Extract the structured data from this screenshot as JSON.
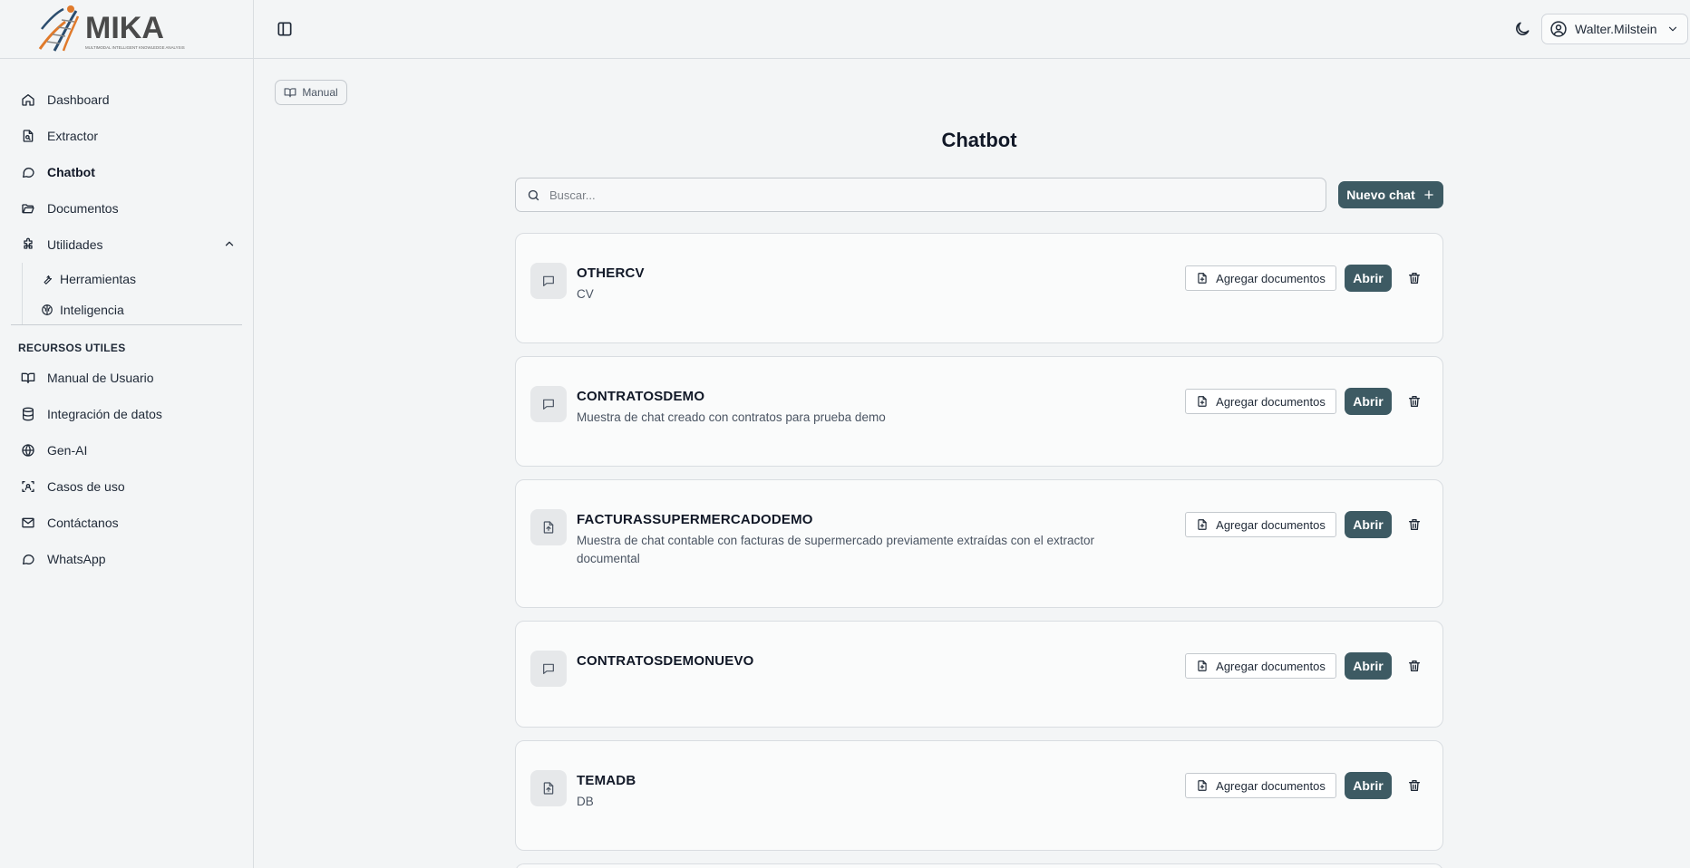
{
  "brand": {
    "name": "MIKA",
    "tagline": "MULTIMODAL INTELLIGENT KNOWLEDGE ANALYSIS"
  },
  "sidebar": {
    "items": [
      {
        "label": "Dashboard",
        "icon": "home-icon"
      },
      {
        "label": "Extractor",
        "icon": "file-search-icon"
      },
      {
        "label": "Chatbot",
        "icon": "chat-bubble-icon",
        "active": true
      },
      {
        "label": "Documentos",
        "icon": "folder-open-icon"
      },
      {
        "label": "Utilidades",
        "icon": "puzzle-icon",
        "expanded": true
      }
    ],
    "subitems": [
      {
        "label": "Herramientas",
        "icon": "wrench-icon"
      },
      {
        "label": "Inteligencia",
        "icon": "brain-icon"
      }
    ],
    "section_title": "RECURSOS UTILES",
    "resources": [
      {
        "label": "Manual de Usuario",
        "icon": "book-open-icon"
      },
      {
        "label": "Integración de datos",
        "icon": "database-icon"
      },
      {
        "label": "Gen-AI",
        "icon": "globe-icon"
      },
      {
        "label": "Casos de uso",
        "icon": "scan-icon"
      },
      {
        "label": "Contáctanos",
        "icon": "mail-icon"
      },
      {
        "label": "WhatsApp",
        "icon": "whatsapp-icon"
      }
    ]
  },
  "header": {
    "user_name": "Walter.Milstein"
  },
  "main": {
    "manual_label": "Manual",
    "title": "Chatbot",
    "search_placeholder": "Buscar...",
    "new_chat_label": "Nuevo chat",
    "add_docs_label": "Agregar documentos",
    "open_label": "Abrir",
    "chats": [
      {
        "title": "OTHERCV",
        "description": "CV",
        "icon": "chat-bubble-icon"
      },
      {
        "title": "CONTRATOSDEMO",
        "description": "Muestra de chat creado con contratos para prueba demo",
        "icon": "chat-bubble-icon"
      },
      {
        "title": "FACTURASSUPERMERCADODEMO",
        "description": "Muestra de chat contable con facturas de supermercado previamente extraídas con el extractor documental",
        "icon": "file-upload-icon"
      },
      {
        "title": "CONTRATOSDEMONUEVO",
        "description": "",
        "icon": "chat-bubble-icon"
      },
      {
        "title": "TEMADB",
        "description": "DB",
        "icon": "file-upload-icon"
      }
    ]
  },
  "colors": {
    "accent": "#3d5a63",
    "background": "#f3f5f6",
    "card": "#fafbfb"
  }
}
